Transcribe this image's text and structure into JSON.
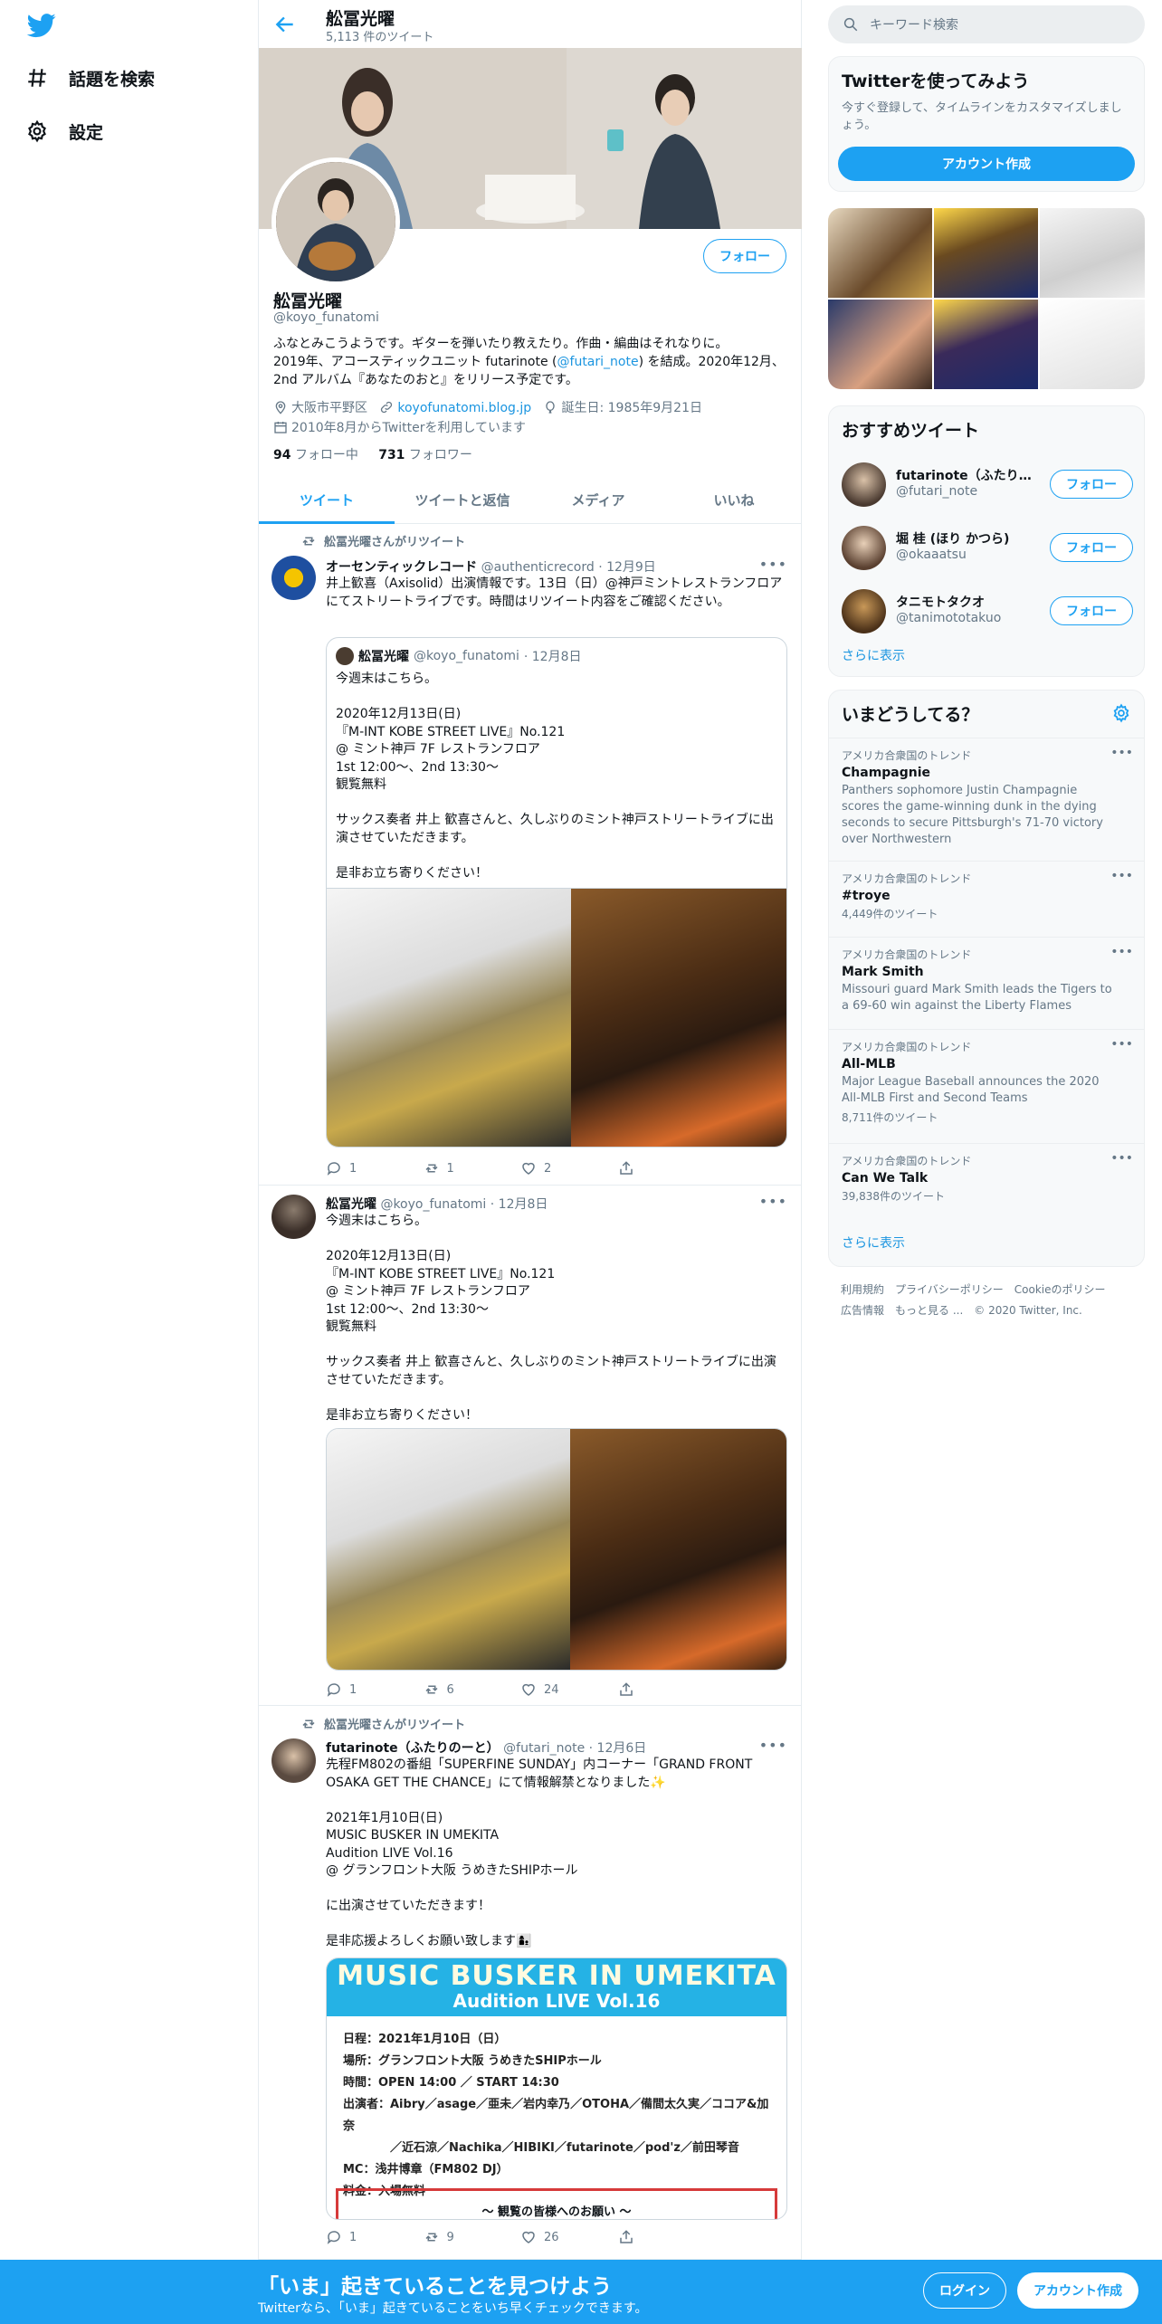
{
  "nav": {
    "explore_label": "話題を検索",
    "settings_label": "設定"
  },
  "header": {
    "name": "舩冨光曜",
    "tweet_count": "5,113 件のツイート"
  },
  "profile": {
    "follow_label": "フォロー",
    "name": "舩冨光曜",
    "handle": "@koyo_funatomi",
    "bio_1": "ふなとみこうようです。ギターを弾いたり教えたり。作曲・編曲はそれなりに。",
    "bio_2": "2019年、アコースティックユニット futarinote (",
    "bio_mention": "@futari_note",
    "bio_3": ") を結成。2020年12月、",
    "bio_4": "2nd アルバム『あなたのおと』をリリース予定です。",
    "location": "大阪市平野区",
    "website": "koyofunatomi.blog.jp",
    "birthday": "誕生日: 1985年9月21日",
    "joined": "2010年8月からTwitterを利用しています",
    "following_count": "94",
    "following_label": "フォロー中",
    "followers_count": "731",
    "followers_label": "フォロワー"
  },
  "tabs": [
    "ツイート",
    "ツイートと返信",
    "メディア",
    "いいね"
  ],
  "tweets": [
    {
      "retweet_label": "舩冨光曜さんがリツイート",
      "author": "オーセンティックレコード",
      "handle": "@authenticrecord",
      "date": "· 12月9日",
      "text": "井上歓喜（Axisolid）出演情報です。13日（日）@神戸ミントレストランフロアにてストリートライブです。時間はリツイート内容をご確認ください。",
      "quote": {
        "author": "舩冨光曜",
        "handle": "@koyo_funatomi",
        "date": "· 12月8日",
        "text": "今週末はこちら。\n\n2020年12月13日(日)\n『M-INT KOBE STREET LIVE』No.121\n@ ミント神戸 7F レストランフロア\n1st 12:00〜、2nd 13:30〜\n観覧無料\n\nサックス奏者 井上 歓喜さんと、久しぶりのミント神戸ストリートライブに出演させていただきます。\n\n是非お立ち寄りください！"
      },
      "replies": "1",
      "retweets": "1",
      "likes": "2"
    },
    {
      "author": "舩冨光曜",
      "handle": "@koyo_funatomi",
      "date": "· 12月8日",
      "text": "今週末はこちら。\n\n2020年12月13日(日)\n『M-INT KOBE STREET LIVE』No.121\n@ ミント神戸 7F レストランフロア\n1st 12:00〜、2nd 13:30〜\n観覧無料\n\nサックス奏者 井上 歓喜さんと、久しぶりのミント神戸ストリートライブに出演させていただきます。\n\n是非お立ち寄りください！",
      "replies": "1",
      "retweets": "6",
      "likes": "24"
    },
    {
      "retweet_label": "舩冨光曜さんがリツイート",
      "author": "futarinote（ふたりのーと）",
      "handle": "@futari_note",
      "date": "· 12月6日",
      "text": "先程FM802の番組「SUPERFINE SUNDAY」内コーナー「GRAND FRONT OSAKA GET THE CHANCE」にて情報解禁となりました✨\n\n2021年1月10日(日)\nMUSIC BUSKER IN UMEKITA\nAudition LIVE Vol.16\n@ グランフロント大阪 うめきたSHIPホール\n\nに出演させていただきます！\n\n是非応援よろしくお願い致します👩‍👦",
      "flyer": {
        "title": "MUSIC BUSKER IN UMEKITA",
        "subtitle": "Audition LIVE Vol.16",
        "body": "日程：2021年1月10日（日）\n場所：グランフロント大阪 うめきたSHIPホール\n時間：OPEN 14:00 ／ START 14:30\n出演者：Aibry／asage／亜未／岩内幸乃／OTOHA／備間太久実／ココア&加奈\n　　　　／近石涼／Nachika／HIBIKI／futarinote／pod'z／前田琴音\nMC：浅井博章（FM802 DJ）\n料金：入場無料",
        "notice": "〜 観覧の皆様へのお願い 〜"
      },
      "replies": "1",
      "retweets": "9",
      "likes": "26"
    }
  ],
  "sidebar": {
    "search_placeholder": "キーワード検索",
    "signup_title": "Twitterを使ってみよう",
    "signup_sub": "今すぐ登録して、タイムラインをカスタマイズしましょう。",
    "signup_button": "アカウント作成",
    "recommend_title": "おすすめツイート",
    "suggestions": [
      {
        "name": "futarinote（ふたりの…",
        "handle": "@futari_note",
        "button": "フォロー"
      },
      {
        "name": "堀 桂 (ほり かつら)",
        "handle": "@okaaatsu",
        "button": "フォロー"
      },
      {
        "name": "タニモトタクオ",
        "handle": "@tanimototakuo",
        "button": "フォロー"
      }
    ],
    "show_more": "さらに表示",
    "trends_title": "いまどうしてる？",
    "trends": [
      {
        "context": "アメリカ合衆国のトレンド",
        "name": "Champagnie",
        "desc": "Panthers sophomore Justin Champagnie scores the game-winning dunk in the dying seconds to secure Pittsburgh's 71-70 victory over Northwestern"
      },
      {
        "context": "アメリカ合衆国のトレンド",
        "name": "#troye",
        "count": "4,449件のツイート"
      },
      {
        "context": "アメリカ合衆国のトレンド",
        "name": "Mark Smith",
        "desc": "Missouri guard Mark Smith leads the Tigers to a 69-60 win against the Liberty Flames"
      },
      {
        "context": "アメリカ合衆国のトレンド",
        "name": "All-MLB",
        "desc": "Major League Baseball announces the 2020 All-MLB First and Second Teams",
        "count": "8,711件のツイート"
      },
      {
        "context": "アメリカ合衆国のトレンド",
        "name": "Can We Talk",
        "count": "39,838件のツイート"
      }
    ],
    "trends_show_more": "さらに表示",
    "footer_1": "利用規約　プライバシーポリシー　Cookieのポリシー",
    "footer_2": "広告情報　もっと見る ...　© 2020 Twitter, Inc."
  },
  "bottom": {
    "title": "「いま」起きていることを見つけよう",
    "sub": "Twitterなら、「いま」起きていることをいち早くチェックできます。",
    "login": "ログイン",
    "signup": "アカウント作成"
  },
  "colors": {
    "accent": "#1da1f2",
    "text": "#0f1419",
    "secondary": "#657786"
  }
}
